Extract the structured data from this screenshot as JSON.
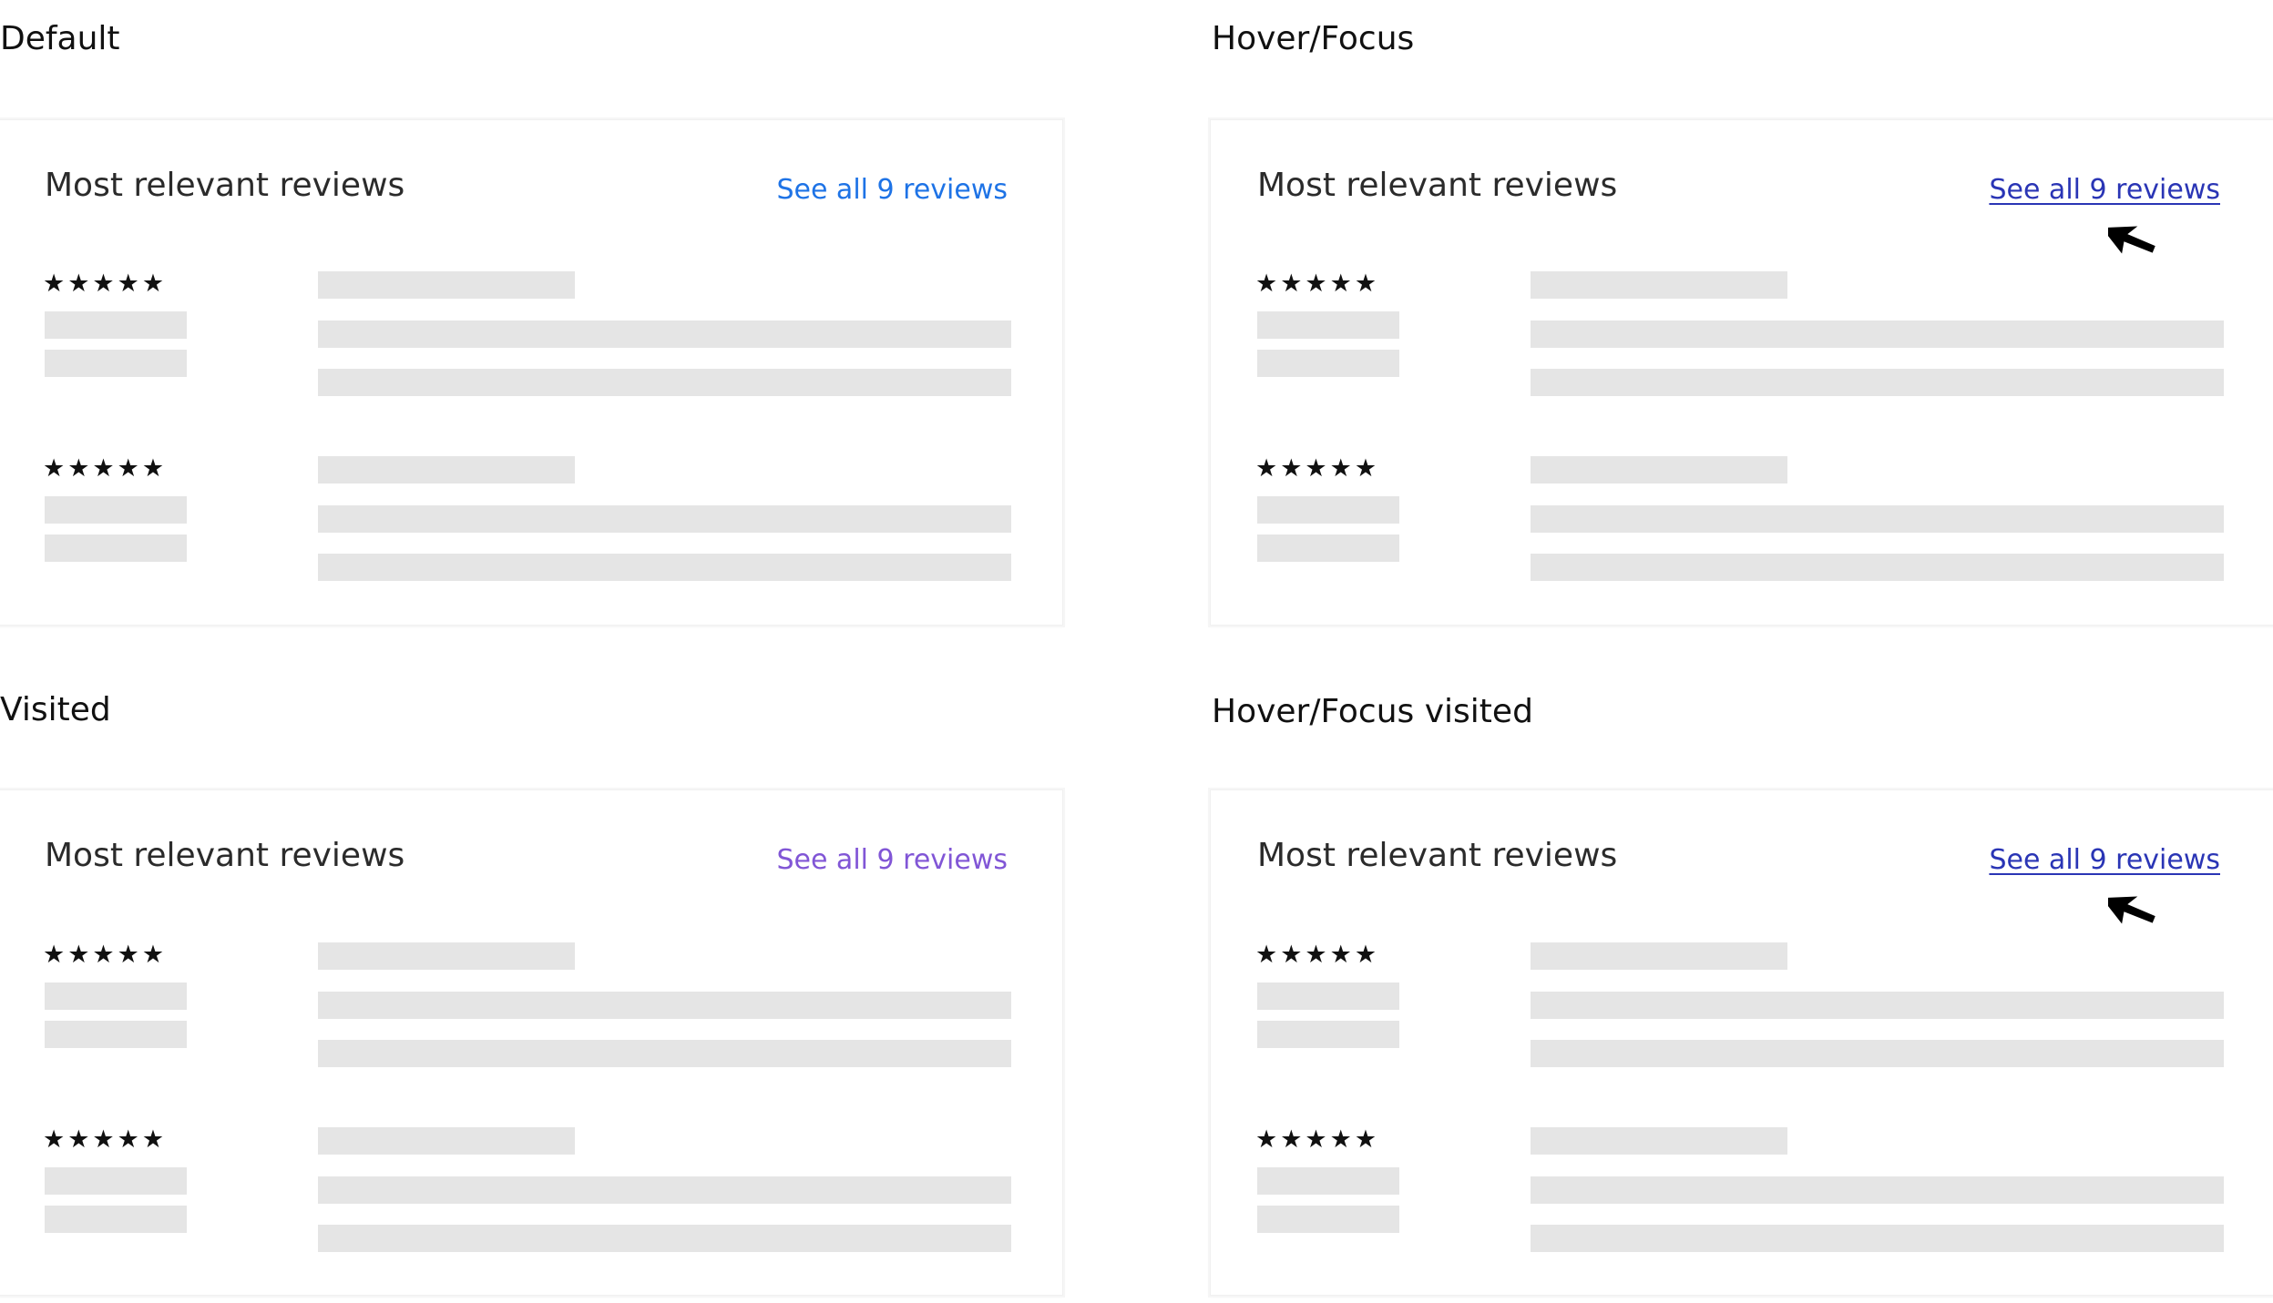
{
  "states": [
    {
      "label": "Default",
      "card": {
        "title": "Most relevant reviews",
        "link": "See all 9 reviews",
        "link_state": "default",
        "reviews": [
          {
            "stars": "★★★★★"
          },
          {
            "stars": "★★★★★"
          }
        ]
      }
    },
    {
      "label": "Hover/Focus",
      "card": {
        "title": "Most relevant reviews",
        "link": "See all 9 reviews",
        "link_state": "hover",
        "reviews": [
          {
            "stars": "★★★★★"
          },
          {
            "stars": "★★★★★"
          }
        ]
      }
    },
    {
      "label": "Visited",
      "card": {
        "title": "Most relevant reviews",
        "link": "See all 9 reviews",
        "link_state": "visited",
        "reviews": [
          {
            "stars": "★★★★★"
          },
          {
            "stars": "★★★★★"
          }
        ]
      }
    },
    {
      "label": "Hover/Focus visited",
      "card": {
        "title": "Most relevant reviews",
        "link": "See all 9 reviews",
        "link_state": "hover",
        "reviews": [
          {
            "stars": "★★★★★"
          },
          {
            "stars": "★★★★★"
          }
        ]
      }
    }
  ],
  "colors": {
    "link_default": "#1e73e6",
    "link_visited": "#8156d6",
    "link_hover": "#2a35b5",
    "skeleton": "#e5e5e5"
  },
  "icons": {
    "rating": "star-icon",
    "pointer": "cursor-arrow-icon"
  }
}
